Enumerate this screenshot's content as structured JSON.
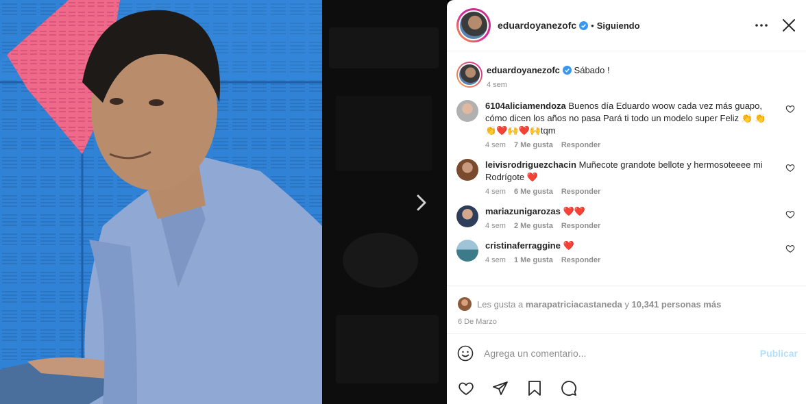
{
  "post": {
    "username": "eduardoyanezofc",
    "separator": "•",
    "follow_state": "Siguiendo",
    "caption_text": "Sábado !",
    "caption_time": "4 sem"
  },
  "comments": [
    {
      "username": "6104aliciamendoza",
      "text": "Buenos día Eduardo woow cada vez más guapo, cómo dicen los años no pasa Pará ti todo un modelo super Feliz 👏 👏👏❤️🙌❤️🙌tqm",
      "time": "4 sem",
      "likes": "7 Me gusta",
      "reply": "Responder"
    },
    {
      "username": "leivisrodriguezchacin",
      "text": "Muñecote grandote bellote y hermosoteeee mi Rodrígote ❤️",
      "time": "4 sem",
      "likes": "6 Me gusta",
      "reply": "Responder"
    },
    {
      "username": "mariazunigarozas",
      "text": "❤️❤️",
      "time": "4 sem",
      "likes": "2 Me gusta",
      "reply": "Responder"
    },
    {
      "username": "cristinaferraggine",
      "text": "❤️",
      "time": "4 sem",
      "likes": "1 Me gusta",
      "reply": "Responder"
    }
  ],
  "likes": {
    "prefix": "Les gusta a",
    "user": "marapatriciacastaneda",
    "joiner": "y",
    "others": "10,341 personas más"
  },
  "date": "6 De Marzo",
  "composer": {
    "placeholder": "Agrega un comentario...",
    "publish_label": "Publicar"
  },
  "icons": {
    "verified": "verified-badge-icon",
    "more": "more-options-icon",
    "close": "close-icon",
    "next": "chevron-right-icon",
    "emoji": "emoji-icon",
    "like": "heart-icon",
    "share": "paper-plane-icon",
    "save": "bookmark-icon",
    "comment": "comment-icon"
  },
  "colors": {
    "verified": "#3897f0",
    "publish_disabled": "#b2dffc",
    "muted_text": "#8e8e8e",
    "text": "#262626"
  }
}
